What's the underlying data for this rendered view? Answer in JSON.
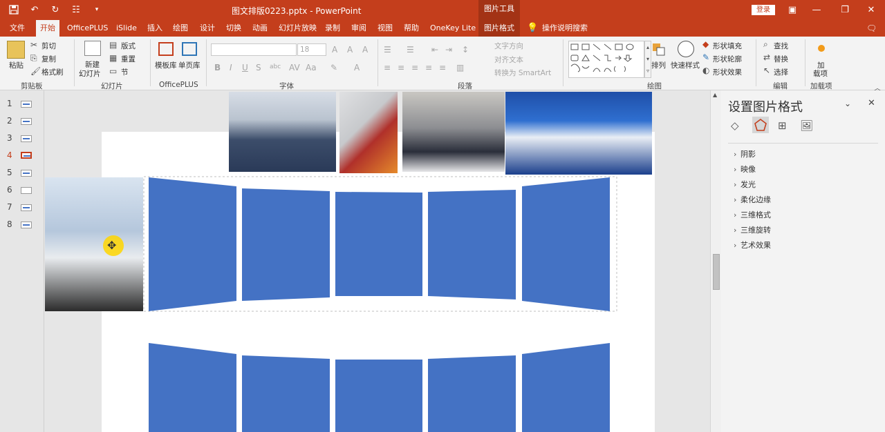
{
  "app": {
    "document_title": "图文排版0223.pptx - PowerPoint",
    "context_tools": "图片工具",
    "login": "登录"
  },
  "tabs": [
    "文件",
    "开始",
    "OfficePLUS",
    "iSlide",
    "插入",
    "绘图",
    "设计",
    "切换",
    "动画",
    "幻灯片放映",
    "录制",
    "审阅",
    "视图",
    "帮助",
    "OneKey Lite",
    "图片格式"
  ],
  "tell_me": "操作说明搜索",
  "ribbon": {
    "clipboard": {
      "paste": "粘贴",
      "cut": "剪切",
      "copy": "复制",
      "format_painter": "格式刷",
      "label": "剪贴板"
    },
    "slides": {
      "new_slide_l1": "新建",
      "new_slide_l2": "幻灯片",
      "layout": "版式",
      "reset": "重置",
      "section": "节",
      "label": "幻灯片"
    },
    "officeplus": {
      "templates": "模板库",
      "single_page": "单页库",
      "label": "OfficePLUS"
    },
    "font": {
      "size": "18",
      "label": "字体"
    },
    "paragraph": {
      "text_direction": "文字方向",
      "align_text": "对齐文本",
      "smartart": "转换为 SmartArt",
      "label": "段落"
    },
    "drawing": {
      "arrange": "排列",
      "quick_styles": "快速样式",
      "fill": "形状填充",
      "outline": "形状轮廓",
      "effects": "形状效果",
      "label": "绘图"
    },
    "editing": {
      "find": "查找",
      "replace": "替换",
      "select": "选择",
      "label": "编辑"
    },
    "addins": {
      "addin_l1": "加",
      "addin_l2": "载项",
      "label": "加载项"
    }
  },
  "slide_numbers": [
    "1",
    "2",
    "3",
    "4",
    "5",
    "6",
    "7",
    "8"
  ],
  "active_slide": "4",
  "format_pane": {
    "title": "设置图片格式",
    "sections": [
      "阴影",
      "映像",
      "发光",
      "柔化边缘",
      "三维格式",
      "三维旋转",
      "艺术效果"
    ]
  },
  "colors": {
    "brand": "#c43e1c",
    "shape_fill": "#4472c4"
  }
}
